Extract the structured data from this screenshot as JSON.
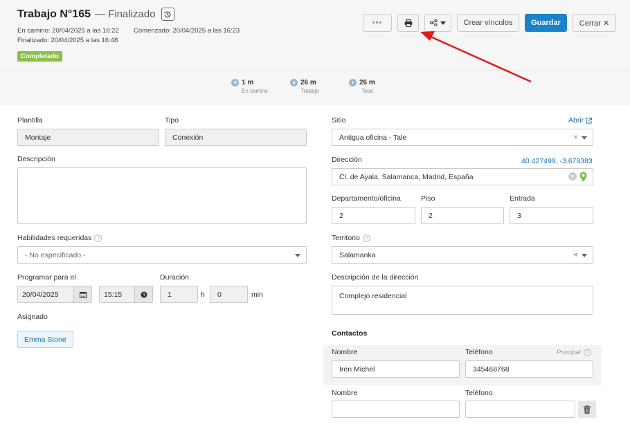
{
  "header": {
    "title": "Trabajo N°165",
    "status": "— Finalizado",
    "on_way": "En camino: 20/04/2025 a las 16:22",
    "started": "Comenzado: 20/04/2025 a las 16:23",
    "finished": "Finalizado: 20/04/2025 a las 16:48",
    "badge": "Completado"
  },
  "toolbar": {
    "more_label": "•••",
    "create_links_label": "Crear vínculos",
    "save_label": "Guardar",
    "close_label": "Cerrar ✕"
  },
  "stats": [
    {
      "value": "1 m",
      "label": "En camino"
    },
    {
      "value": "26 m",
      "label": "Trabajo"
    },
    {
      "value": "26 m",
      "label": "Total"
    }
  ],
  "form": {
    "template_label": "Plantilla",
    "template_value": "Montaje",
    "type_label": "Tipo",
    "type_value": "Conexión",
    "description_label": "Descripción",
    "description_value": "",
    "skills_label": "Habilidades requeridas",
    "skills_value": "- No especificado -",
    "schedule_label": "Programar para el",
    "schedule_date": "20/04/2025",
    "schedule_time": "15:15",
    "duration_label": "Duración",
    "duration_hours": "1",
    "duration_hours_unit": "h",
    "duration_minutes": "0",
    "duration_minutes_unit": "min",
    "assigned_label": "Asignado",
    "assigned_value": "Emma Stone"
  },
  "site": {
    "site_label": "Sitio",
    "open_link": "Abrir",
    "site_value": "Antigua oficina - Tale",
    "address_label": "Dirección",
    "coordinates": "40.427499, -3.679383",
    "address_value": "Cl. de Ayala, Salamanca, Madrid, España",
    "department_label": "Departamento/oficina",
    "department_value": "2",
    "floor_label": "Piso",
    "floor_value": "2",
    "entrance_label": "Entrada",
    "entrance_value": "3",
    "territory_label": "Territorio",
    "territory_value": "Salamanka",
    "address_desc_label": "Descripción de la dirección",
    "address_desc_value": "Complejo residencial"
  },
  "contacts": {
    "title": "Contactos",
    "name_label": "Nombre",
    "phone_label": "Teléfono",
    "principal_label": "Principal",
    "rows": [
      {
        "name": "Iren Michel",
        "phone": "345468768"
      },
      {
        "name": "",
        "phone": ""
      }
    ]
  },
  "colors": {
    "accent": "#1a82c9",
    "badge_green": "#8bbf4a",
    "annotation_arrow": "#e11b1b",
    "map_pin": "#7ac143"
  }
}
